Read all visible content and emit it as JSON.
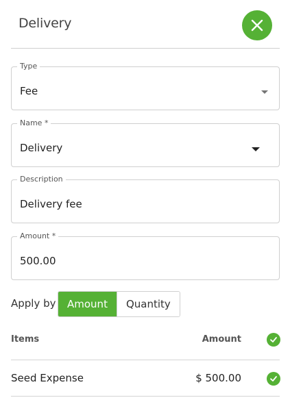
{
  "header": {
    "title": "Delivery"
  },
  "fields": {
    "type": {
      "label": "Type",
      "value": "Fee"
    },
    "name": {
      "label": "Name *",
      "value": "Delivery"
    },
    "description": {
      "label": "Description",
      "value": "Delivery fee"
    },
    "amount": {
      "label": "Amount *",
      "value": "500.00"
    }
  },
  "apply_by": {
    "label": "Apply by",
    "options": [
      "Amount",
      "Quantity"
    ],
    "selected": "Amount"
  },
  "table": {
    "headers": {
      "items": "Items",
      "amount": "Amount"
    },
    "rows": [
      {
        "item": "Seed Expense",
        "amount": "$ 500.00",
        "checked": true
      }
    ]
  },
  "colors": {
    "accent": "#55b135"
  },
  "icons": {
    "close": "close-icon",
    "check": "check-circle-icon",
    "dropdown": "caret-down-icon"
  }
}
